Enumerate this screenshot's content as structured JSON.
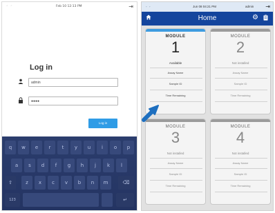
{
  "login_screen": {
    "status": {
      "time": "Feb 10  12:13 PM"
    },
    "title": "Log in",
    "username": "admin",
    "password": "●●●●",
    "login_button": "Log in",
    "keyboard": {
      "row1": [
        "q",
        "w",
        "e",
        "r",
        "t",
        "y",
        "u",
        "i",
        "o",
        "p"
      ],
      "row2": [
        "a",
        "s",
        "d",
        "f",
        "g",
        "h",
        "j",
        "k",
        "l"
      ],
      "row3": [
        "z",
        "x",
        "c",
        "v",
        "b",
        "n",
        "m"
      ],
      "numbers_key": "123"
    }
  },
  "home_screen": {
    "status": {
      "time": "Jun 08  04:21 PM",
      "user": "admin"
    },
    "title": "Home",
    "modules": [
      {
        "label": "MODULE",
        "number": "1",
        "status": "Available",
        "fields": [
          "Assay Name",
          "Sample ID",
          "Time Remaining"
        ]
      },
      {
        "label": "MODULE",
        "number": "2",
        "status": "Not installed",
        "fields": [
          "Assay Name",
          "Sample ID",
          "Time Remaining"
        ]
      },
      {
        "label": "MODULE",
        "number": "3",
        "status": "Not installed",
        "fields": [
          "Assay Name",
          "Sample ID",
          "Time Remaining"
        ]
      },
      {
        "label": "MODULE",
        "number": "4",
        "status": "Not installed",
        "fields": [
          "Assay Name",
          "Sample ID",
          "Time Remaining"
        ]
      }
    ]
  },
  "colors": {
    "appbar": "#14459d",
    "accent": "#3d9ce0",
    "pointer": "#1e6fbf",
    "keyboard": "#263766"
  }
}
